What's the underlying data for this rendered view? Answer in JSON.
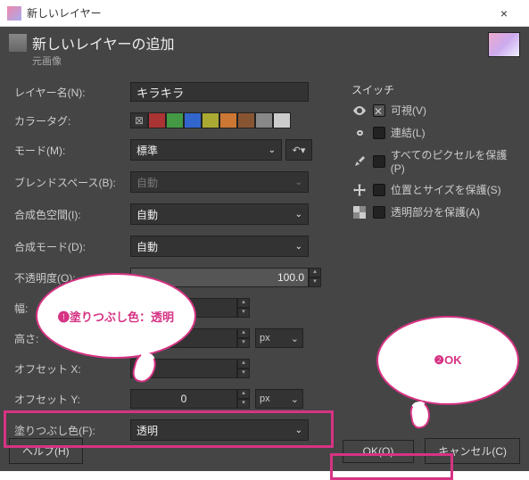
{
  "window": {
    "title": "新しいレイヤー",
    "close": "×"
  },
  "header": {
    "title": "新しいレイヤーの追加",
    "sub": "元画像"
  },
  "labels": {
    "layer_name": "レイヤー名(N):",
    "color_tag": "カラータグ:",
    "mode": "モード(M):",
    "blend_space": "ブレンドスペース(B):",
    "composite_space": "合成色空間(I):",
    "composite_mode": "合成モード(D):",
    "opacity": "不透明度(O):",
    "width": "幅:",
    "height": "高さ:",
    "offset_x": "オフセット X:",
    "offset_y": "オフセット Y:",
    "fill": "塗りつぶし色(F):"
  },
  "values": {
    "layer_name": "キラキラ",
    "mode": "標準",
    "blend_space": "自動",
    "composite_space": "自動",
    "composite_mode": "自動",
    "opacity": "100.0",
    "offset_y": "0",
    "unit": "px",
    "fill": "透明"
  },
  "colortags": [
    "#555",
    "#a33",
    "#494",
    "#36c",
    "#aa3",
    "#c73",
    "#853",
    "#888",
    "#ccc"
  ],
  "switches": {
    "title": "スイッチ",
    "visible": "可視(V)",
    "linked": "連結(L)",
    "lock_pixels": "すべてのピクセルを保護(P)",
    "lock_pos": "位置とサイズを保護(S)",
    "lock_alpha": "透明部分を保護(A)"
  },
  "buttons": {
    "help": "ヘルプ(H)",
    "ok": "OK(O)",
    "cancel": "キャンセル(C)"
  },
  "callouts": {
    "b1": "❶塗りつぶし色：透明",
    "b2": "❷OK"
  }
}
